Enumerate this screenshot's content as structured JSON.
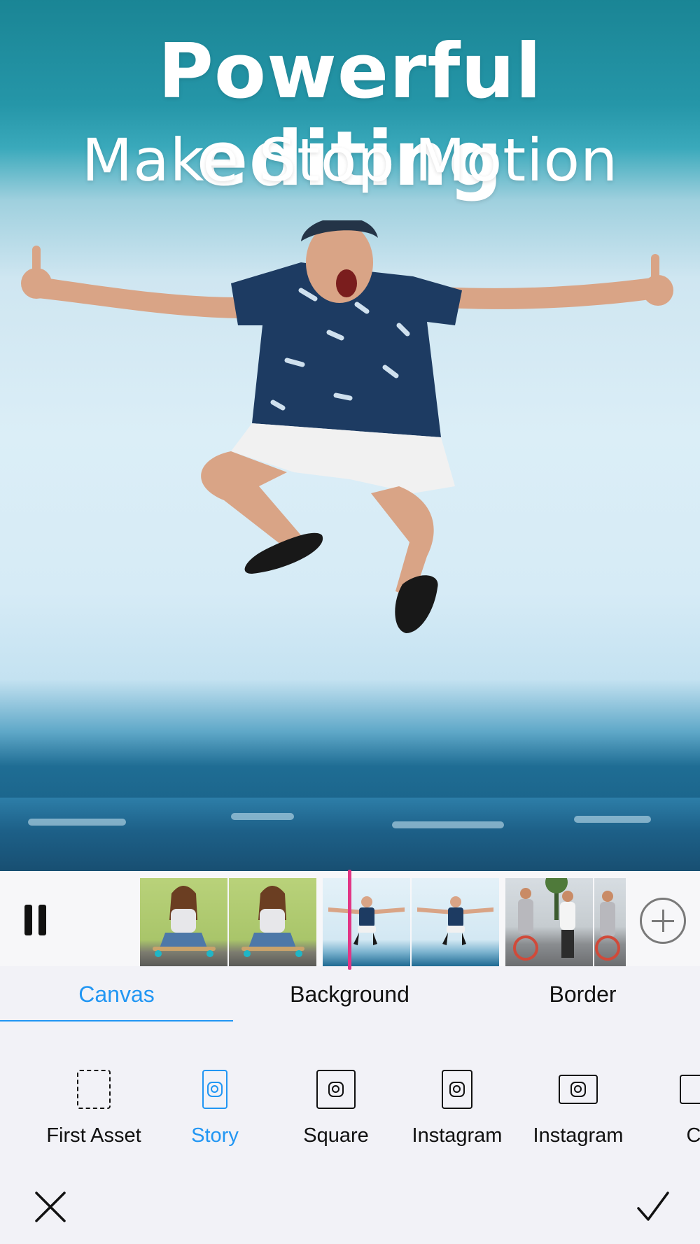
{
  "preview": {
    "headline": "Powerful editing",
    "subheadline": "Make Stop Motion"
  },
  "timeline": {
    "clips": [
      "girl-on-skateboard",
      "man-jumping",
      "friends-on-street"
    ],
    "playhead_color": "#e23585"
  },
  "tabs": [
    {
      "label": "Canvas",
      "active": true
    },
    {
      "label": "Background",
      "active": false
    },
    {
      "label": "Border",
      "active": false
    }
  ],
  "canvas_options": [
    {
      "label": "First Asset",
      "icon": "dashed-frame-icon"
    },
    {
      "label": "Story",
      "icon": "instagram-story-icon",
      "active": true
    },
    {
      "label": "Square",
      "icon": "instagram-square-icon"
    },
    {
      "label": "Instagram",
      "icon": "instagram-portrait-icon"
    },
    {
      "label": "Instagram",
      "icon": "instagram-landscape-icon"
    },
    {
      "label": "Co",
      "icon": "cover-icon"
    }
  ],
  "colors": {
    "accent": "#2196f3",
    "playhead": "#e23585"
  }
}
